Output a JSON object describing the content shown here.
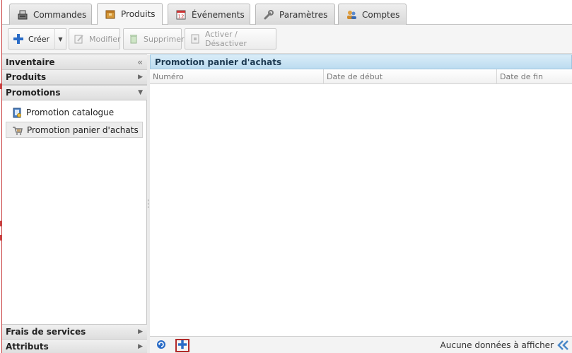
{
  "tabs": [
    {
      "label": "Commandes",
      "icon": "cash-register-icon",
      "active": false
    },
    {
      "label": "Produits",
      "icon": "box-icon",
      "active": true
    },
    {
      "label": "Événements",
      "icon": "calendar-icon",
      "active": false
    },
    {
      "label": "Paramètres",
      "icon": "wrench-icon",
      "active": false
    },
    {
      "label": "Comptes",
      "icon": "users-icon",
      "active": false
    }
  ],
  "toolbar": {
    "create_label": "Créer",
    "modify_label": "Modifier",
    "delete_label": "Supprimer",
    "toggle_label": "Activer / Désactiver"
  },
  "sidebar": {
    "sections": [
      {
        "label": "Inventaire",
        "state": "collapse-left"
      },
      {
        "label": "Produits",
        "state": "collapsed"
      },
      {
        "label": "Promotions",
        "state": "expanded"
      },
      {
        "label": "Frais de services",
        "state": "collapsed"
      },
      {
        "label": "Attributs",
        "state": "collapsed"
      }
    ],
    "promotion_items": [
      {
        "label": "Promotion catalogue",
        "icon": "catalog-promo-icon",
        "selected": false
      },
      {
        "label": "Promotion panier d'achats",
        "icon": "cart-promo-icon",
        "selected": true
      }
    ]
  },
  "main": {
    "title": "Promotion panier d'achats",
    "columns": [
      "Numéro",
      "Date de début",
      "Date de fin"
    ],
    "rows": [],
    "empty_message": "Aucune données à afficher"
  },
  "colors": {
    "accent_header": "#bcdcf0",
    "add_highlight": "#b22a2a",
    "frame": "#c94040"
  }
}
